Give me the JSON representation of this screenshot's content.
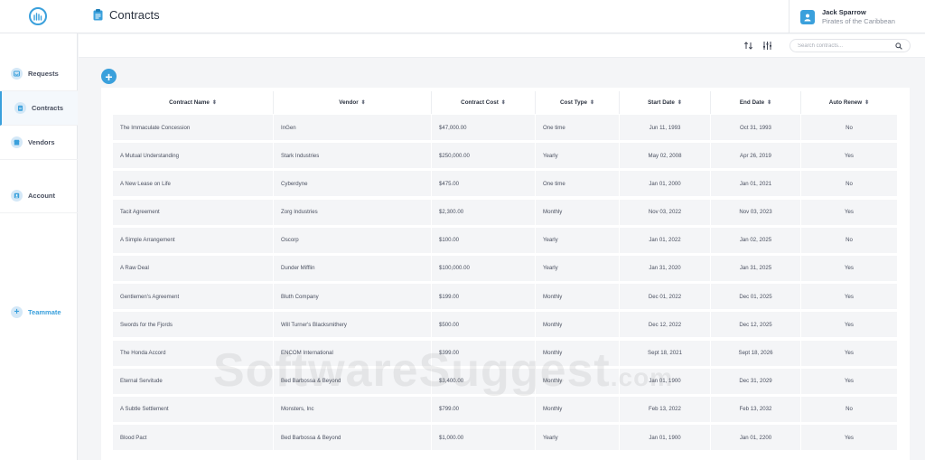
{
  "header": {
    "title": "Contracts",
    "user": {
      "name": "Jack Sparrow",
      "org": "Pirates of the Caribbean"
    }
  },
  "sidebar": {
    "items": [
      {
        "label": "Requests",
        "icon": "inbox-icon"
      },
      {
        "label": "Contracts",
        "icon": "clipboard-icon",
        "active": true
      },
      {
        "label": "Vendors",
        "icon": "store-icon"
      },
      {
        "label": "Account",
        "icon": "id-card-icon"
      }
    ],
    "teammate_label": "Teammate"
  },
  "toolbar": {
    "search_placeholder": "Search contracts..."
  },
  "table": {
    "columns": [
      "Contract Name",
      "Vendor",
      "Contract Cost",
      "Cost Type",
      "Start Date",
      "End Date",
      "Auto Renew"
    ],
    "rows": [
      [
        "The Immaculate Concession",
        "InGen",
        "$47,000.00",
        "One time",
        "Jun 11, 1993",
        "Oct 31, 1993",
        "No"
      ],
      [
        "A Mutual Understanding",
        "Stark Industries",
        "$250,000.00",
        "Yearly",
        "May 02, 2008",
        "Apr 26, 2019",
        "Yes"
      ],
      [
        "A New Lease on Life",
        "Cyberdyne",
        "$475.00",
        "One time",
        "Jan 01, 2000",
        "Jan 01, 2021",
        "No"
      ],
      [
        "Tacit Agreement",
        "Zorg Industries",
        "$2,300.00",
        "Monthly",
        "Nov 03, 2022",
        "Nov 03, 2023",
        "Yes"
      ],
      [
        "A Simple Arrangement",
        "Oscorp",
        "$100.00",
        "Yearly",
        "Jan 01, 2022",
        "Jan 02, 2025",
        "No"
      ],
      [
        "A Raw Deal",
        "Dunder Mifflin",
        "$100,000.00",
        "Yearly",
        "Jan 31, 2020",
        "Jan 31, 2025",
        "Yes"
      ],
      [
        "Gentlemen's Agreement",
        "Bluth Company",
        "$199.00",
        "Monthly",
        "Dec 01, 2022",
        "Dec 01, 2025",
        "Yes"
      ],
      [
        "Swords for the Fjords",
        "Will Turner's Blacksmithery",
        "$500.00",
        "Monthly",
        "Dec 12, 2022",
        "Dec 12, 2025",
        "Yes"
      ],
      [
        "The Honda Accord",
        "ENCOM International",
        "$399.00",
        "Monthly",
        "Sept 18, 2021",
        "Sept 18, 2026",
        "Yes"
      ],
      [
        "Eternal Servitude",
        "Bed Barbossa & Beyond",
        "$3,400.00",
        "Monthly",
        "Jan 01, 1900",
        "Dec 31, 2029",
        "Yes"
      ],
      [
        "A Subtle Settlement",
        "Monsters, Inc",
        "$799.00",
        "Monthly",
        "Feb 13, 2022",
        "Feb 13, 2032",
        "No"
      ],
      [
        "Blood Pact",
        "Bed Barbossa & Beyond",
        "$1,000.00",
        "Yearly",
        "Jan 01, 1900",
        "Jan 01, 2200",
        "Yes"
      ]
    ]
  },
  "watermark": {
    "main": "SoftwareSuggest",
    "suffix": ".com"
  },
  "colors": {
    "accent": "#3aa0dc",
    "row_bg": "#f4f5f7"
  }
}
